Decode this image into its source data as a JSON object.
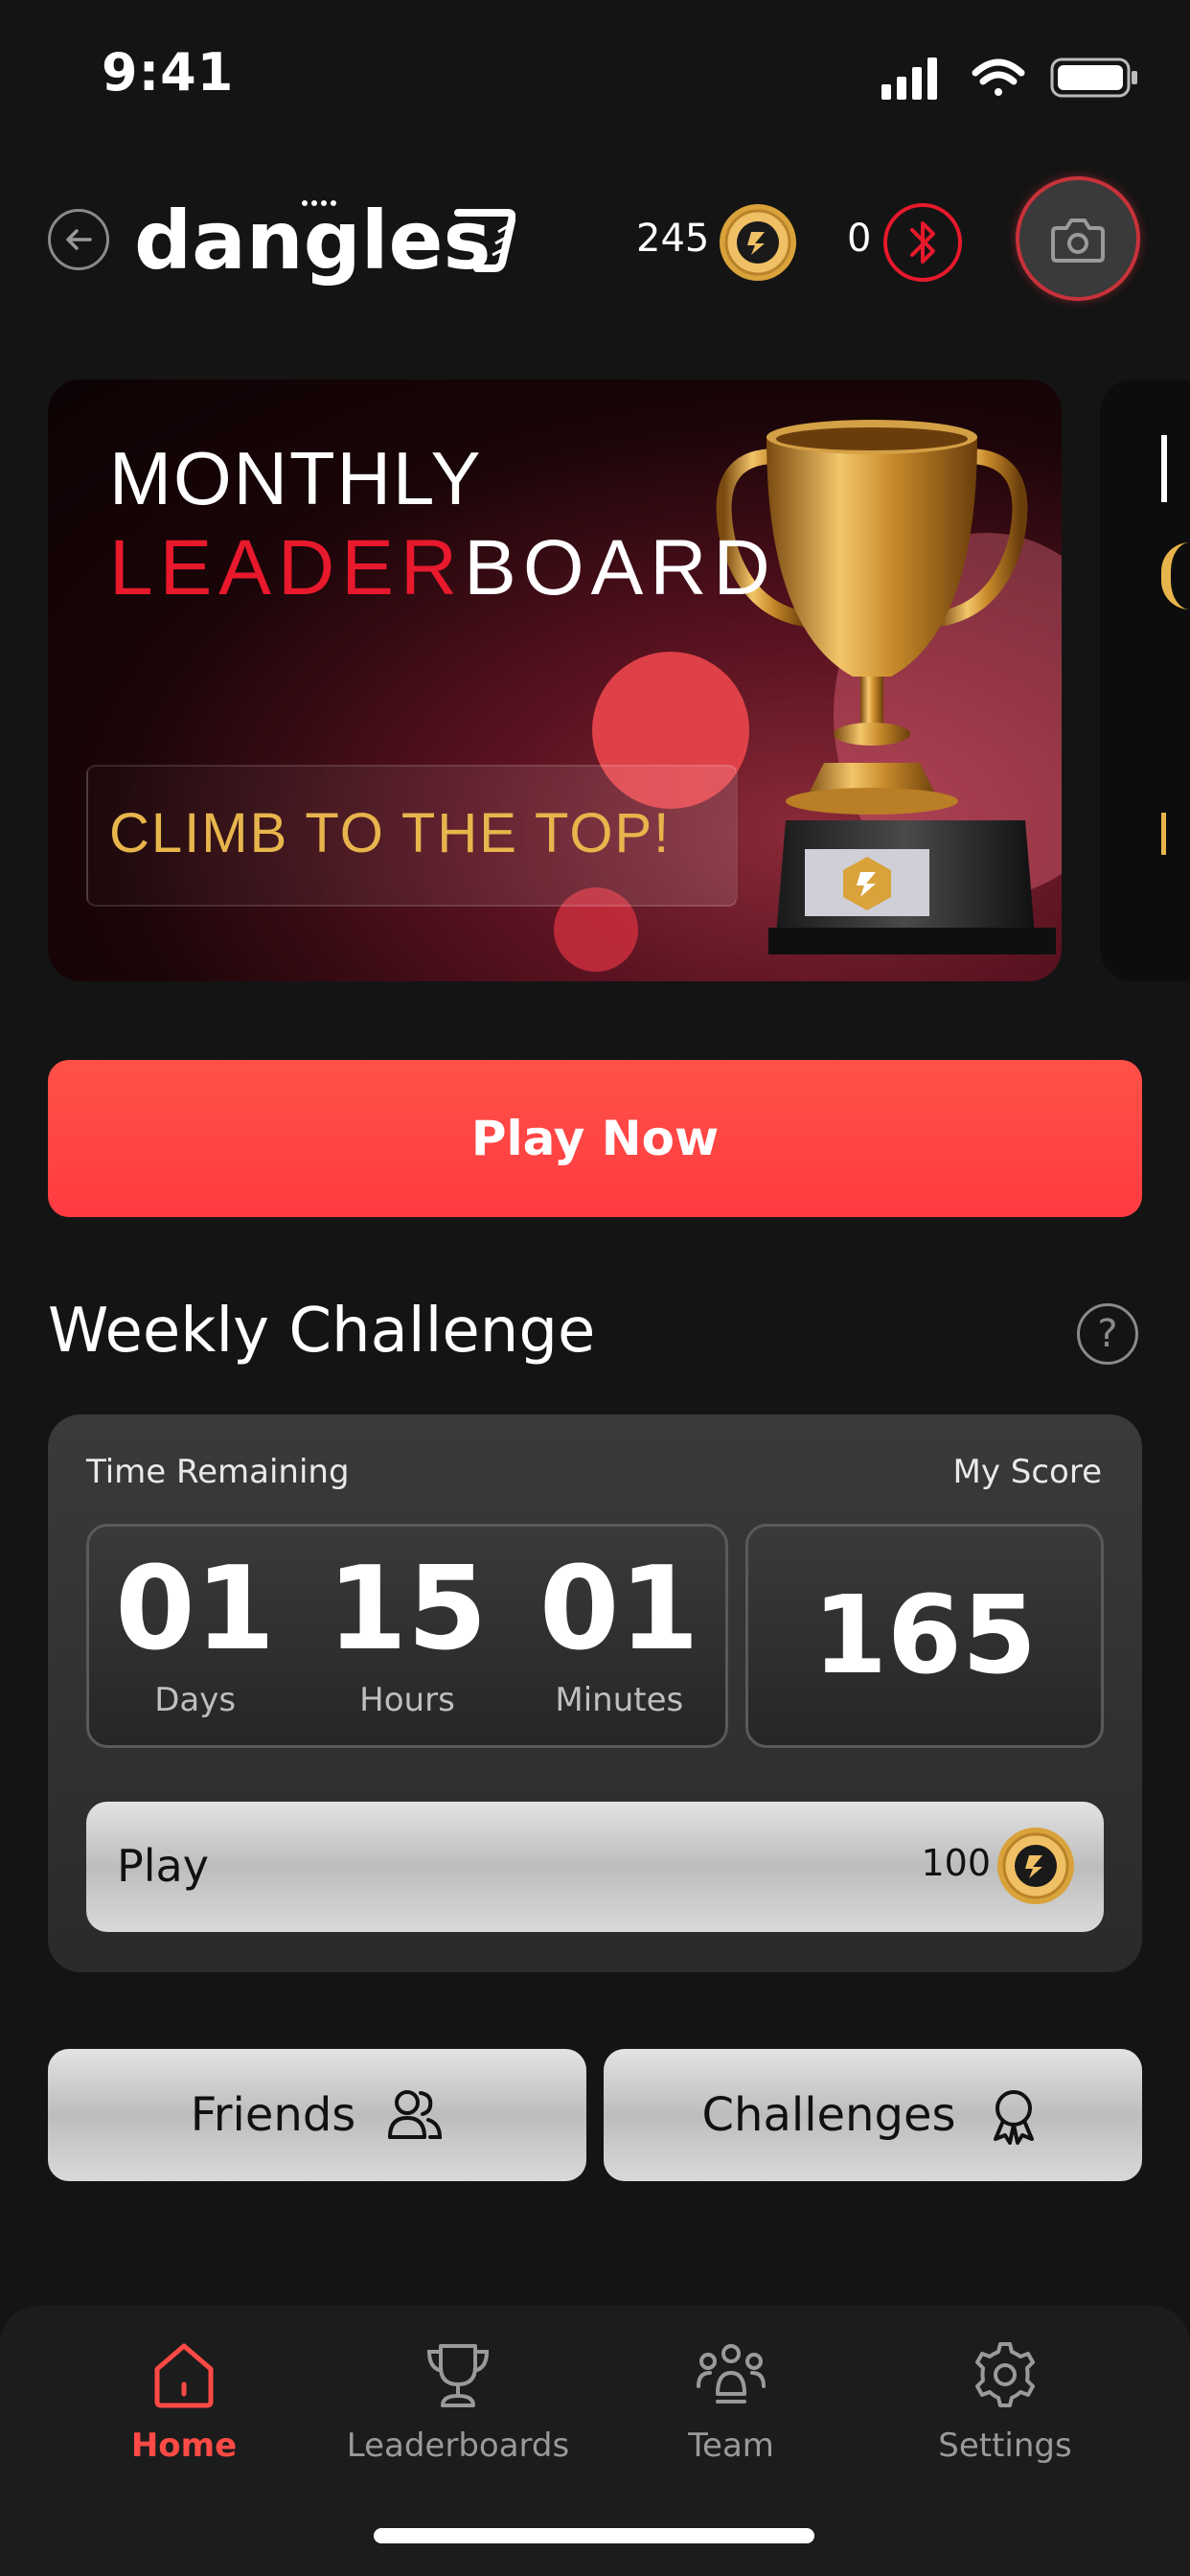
{
  "status_bar": {
    "time": "9:41"
  },
  "header": {
    "logo_text": "dangles",
    "coin_count": "245",
    "bluetooth_count": "0"
  },
  "banner": {
    "title_line1": "MONTHLY",
    "title_red": "LEADER",
    "title_white": "BOARD",
    "cta": "CLIMB TO THE TOP!"
  },
  "play_now_label": "Play Now",
  "weekly_challenge": {
    "title": "Weekly Challenge",
    "help_symbol": "?",
    "time_remaining_label": "Time Remaining",
    "my_score_label": "My Score",
    "timer": [
      {
        "value": "01",
        "unit": "Days"
      },
      {
        "value": "15",
        "unit": "Hours"
      },
      {
        "value": "01",
        "unit": "Minutes"
      }
    ],
    "score": "165",
    "play_label": "Play",
    "play_cost": "100"
  },
  "buttons": {
    "friends": "Friends",
    "challenges": "Challenges"
  },
  "tabs": [
    {
      "label": "Home",
      "active": true
    },
    {
      "label": "Leaderboards",
      "active": false
    },
    {
      "label": "Team",
      "active": false
    },
    {
      "label": "Settings",
      "active": false
    }
  ],
  "colors": {
    "accent": "#ff4a45",
    "gold": "#e7b54c",
    "bluetooth": "#e8192c"
  }
}
